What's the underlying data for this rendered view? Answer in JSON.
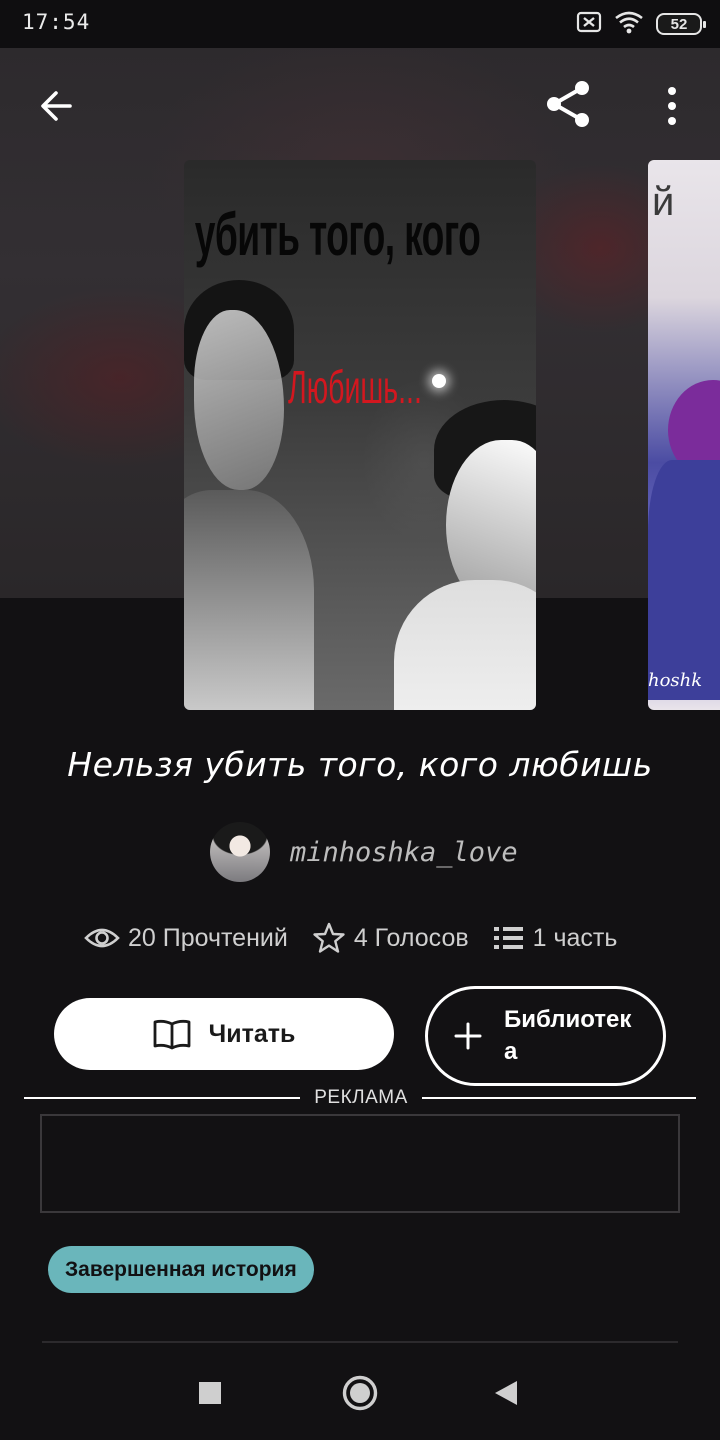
{
  "status_bar": {
    "time": "17:54",
    "battery": "52",
    "icons": [
      "sim-blocked-icon",
      "wifi-icon",
      "battery-icon"
    ]
  },
  "top_bar": {
    "icons": [
      "back-arrow-icon",
      "share-icon",
      "more-vertical-icon"
    ]
  },
  "cover": {
    "text_top": "я убить того, кого",
    "text_mid": "Любишь..."
  },
  "next_cover": {
    "text_top": "й",
    "text_bottom": "hoshk"
  },
  "story": {
    "title": "Нельзя убить того, кого любишь",
    "author": "minhoshka_love"
  },
  "stats": {
    "reads": "20 Прочтений",
    "votes": "4 Голосов",
    "parts": "1 часть"
  },
  "actions": {
    "read_label": "Читать",
    "library_label": "Библиотека"
  },
  "ad": {
    "label": "РЕКЛАМА"
  },
  "badge": {
    "label": "Завершенная история"
  },
  "colors": {
    "background": "#121113",
    "badge": "#6ab6bb",
    "cover_accent": "#d3171f"
  }
}
